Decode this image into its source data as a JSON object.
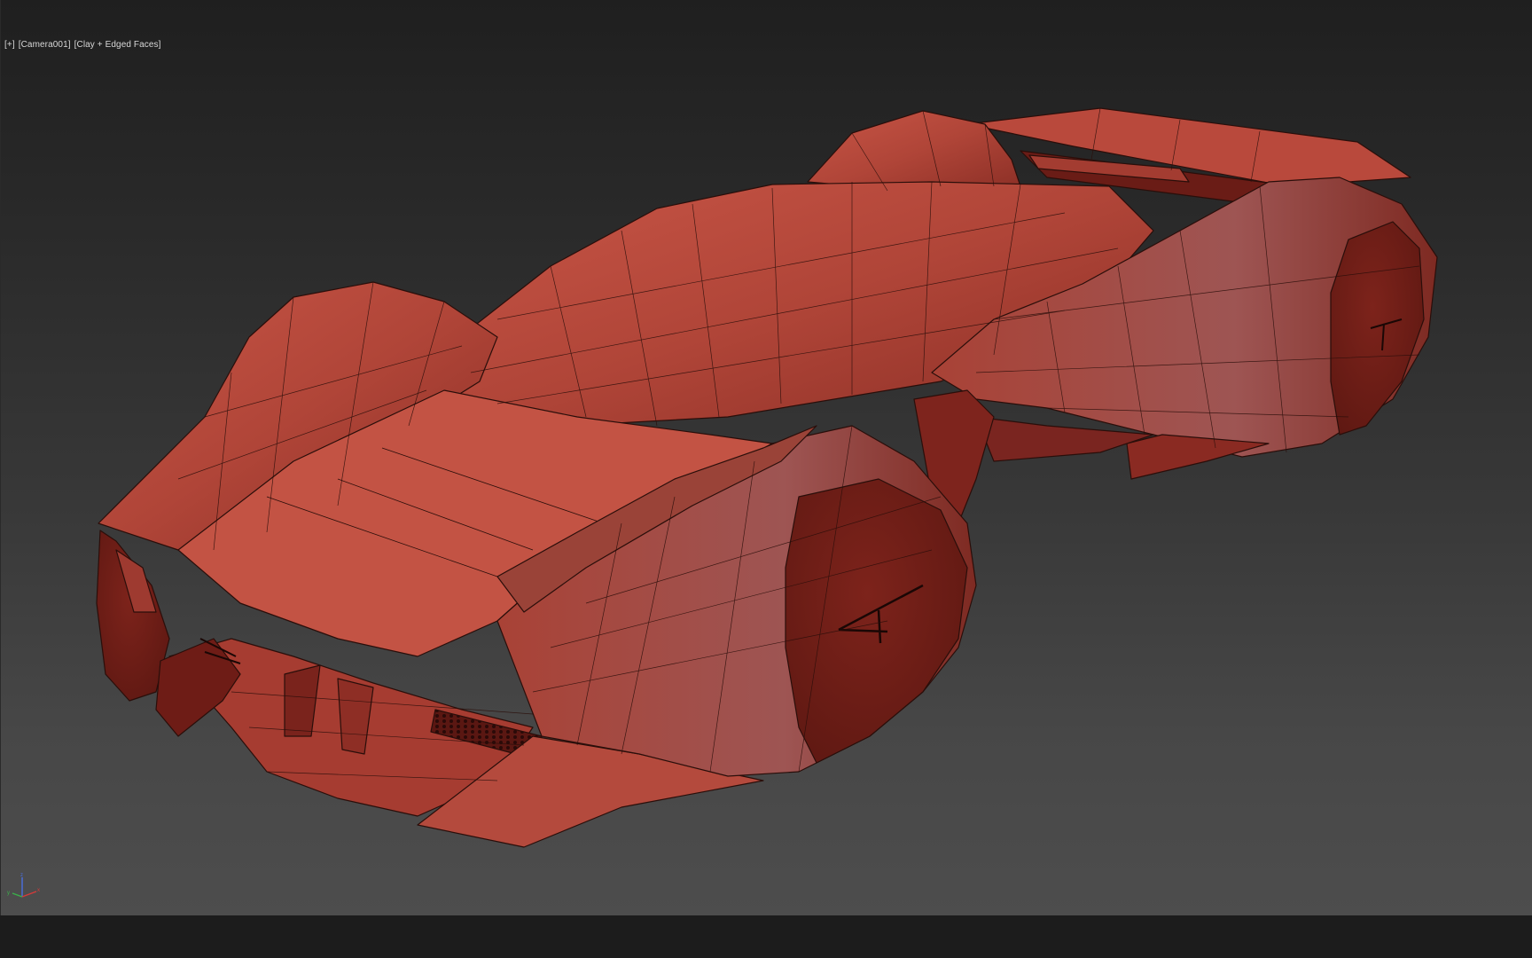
{
  "viewport": {
    "label_parts": [
      "[+]",
      "[Camera001]",
      "[Clay + Edged Faces]"
    ],
    "shading_mode": "Clay + Edged Faces",
    "camera": "Camera001"
  },
  "gizmo": {
    "axes": [
      "x",
      "y",
      "z"
    ],
    "colors": {
      "x": "#d63a3a",
      "y": "#3ab04a",
      "z": "#4a6fe0"
    }
  },
  "model": {
    "clay_color": "#b84a3e",
    "edge_color": "#2a0e0a",
    "dark_color": "#6e1c16"
  }
}
